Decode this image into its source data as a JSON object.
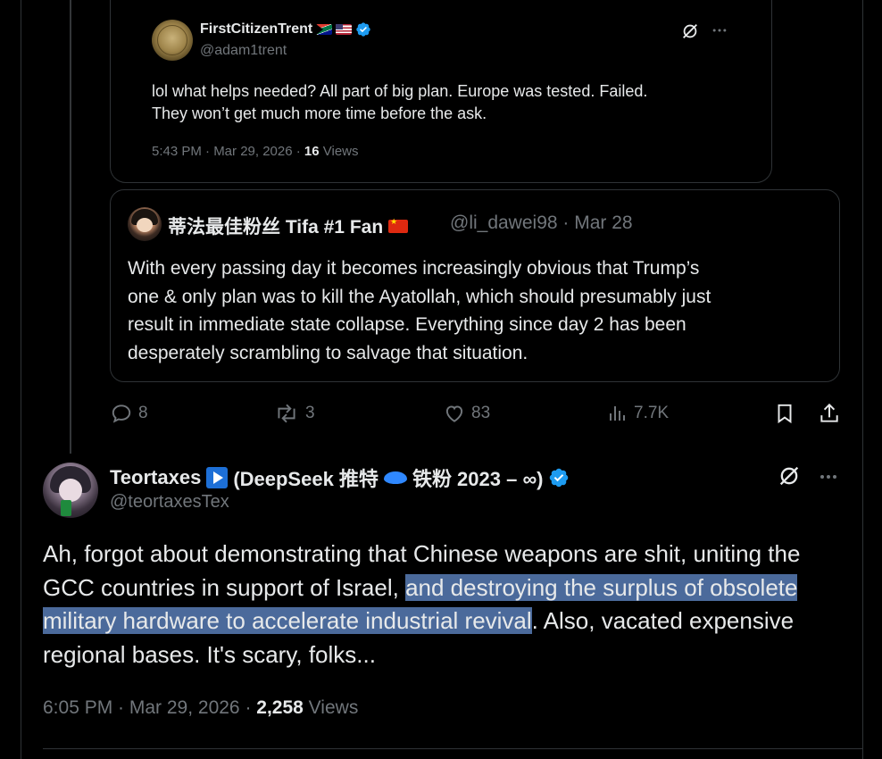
{
  "nested_quote": {
    "name": "FirstCitizenTrent",
    "handle": "@adam1trent",
    "text_line1": "lol what helps needed?  All part of big plan.   Europe was tested.  Failed.",
    "text_line2": "They won’t get much more time before the ask.",
    "time": "5:43 PM · Mar 29, 2026 · ",
    "views_count": "16",
    "views_label": " Views"
  },
  "quoted_tweet": {
    "name": "蒂法最佳粉丝 Tifa #1 Fan",
    "handle_date": "@li_dawei98 · Mar 28",
    "text_line1": "With every passing day it becomes increasingly obvious that Trump’s",
    "text_line2": "one & only plan was to kill the Ayatollah, which should presumably just",
    "text_line3": "result in immediate state collapse. Everything since day 2 has been",
    "text_line4": "desperately scrambling to salvage that situation."
  },
  "actions": {
    "replies": "8",
    "reposts": "3",
    "likes": "83",
    "views": "7.7K"
  },
  "main_tweet": {
    "name_part1": "Teortaxes",
    "name_part2": "(DeepSeek 推特",
    "name_part3": "铁粉 2023 – ∞)",
    "handle": "@teortaxesTex",
    "text_part1": "Ah, forgot about demonstrating that Chinese weapons are shit, uniting the GCC countries in support of Israel, ",
    "text_highlight": "and destroying the surplus of obsolete military hardware to accelerate industrial revival",
    "text_part2": ". Also, vacated expensive regional bases. It's scary, folks...",
    "time": "6:05 PM · Mar 29, 2026 · ",
    "views_count": "2,258",
    "views_label": " Views"
  },
  "colors": {
    "background": "#000000",
    "text": "#e7e9ea",
    "muted": "#71767b",
    "verified": "#1d9bf0",
    "border": "#2f3336",
    "highlight": "#4b6a9b"
  },
  "icons": [
    "grok-icon",
    "more-icon",
    "reply-icon",
    "repost-icon",
    "like-icon",
    "views-icon",
    "bookmark-icon",
    "share-icon",
    "verified-badge-icon"
  ]
}
